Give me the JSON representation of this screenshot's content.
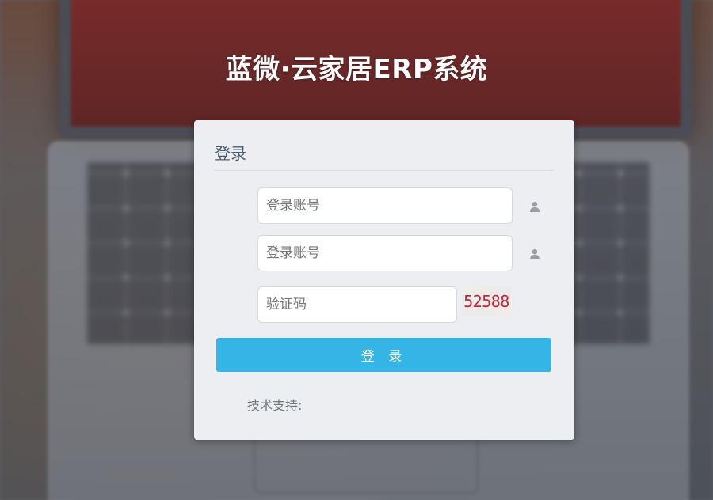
{
  "app": {
    "title": "蓝微·云家居ERP系统"
  },
  "login": {
    "panel_title": "登录",
    "username_placeholder": "登录账号",
    "password_placeholder": "登录账号",
    "captcha_placeholder": "验证码",
    "captcha_code": "52588",
    "submit_label": "登 录",
    "support_label": "技术支持:"
  },
  "colors": {
    "accent": "#35b5e5",
    "panel_bg": "#eceef1",
    "captcha_text": "#c2283c"
  },
  "icons": {
    "username_icon": "user-icon",
    "password_icon": "user-icon"
  }
}
